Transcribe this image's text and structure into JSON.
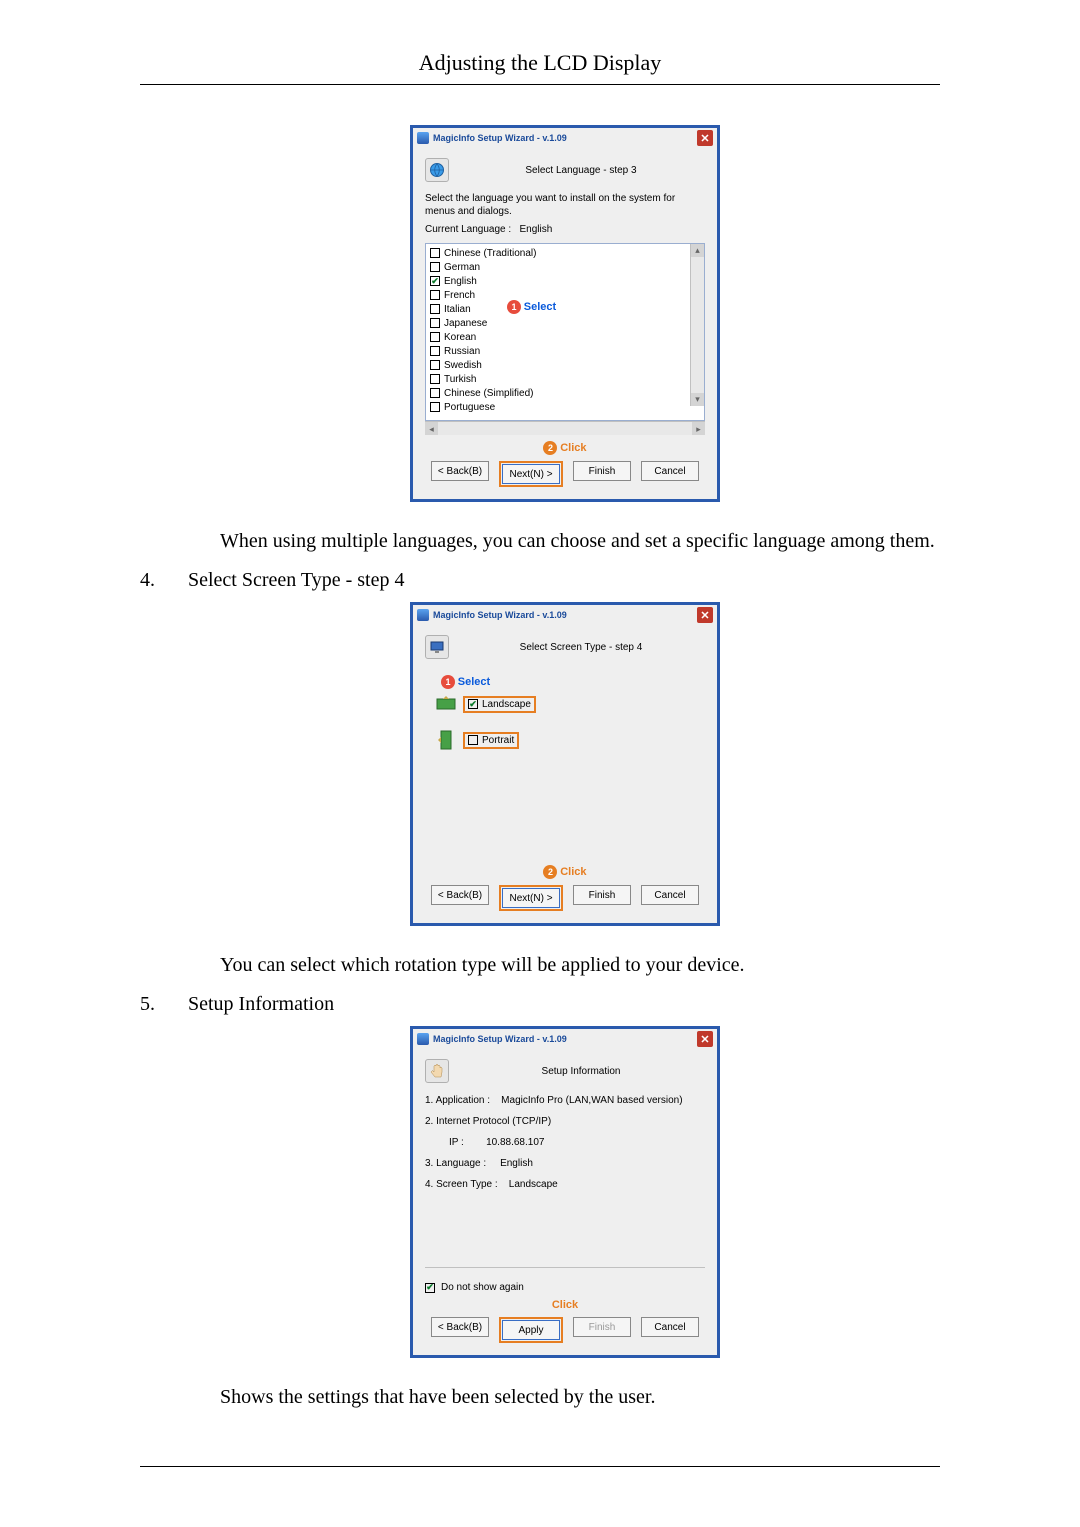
{
  "header": {
    "title": "Adjusting the LCD Display"
  },
  "wizard_common": {
    "title": "MagicInfo Setup Wizard - v.1.09",
    "back": "< Back(B)",
    "next": "Next(N) >",
    "finish": "Finish",
    "cancel": "Cancel",
    "apply": "Apply"
  },
  "callouts": {
    "select": "Select",
    "click": "Click"
  },
  "step3": {
    "heading": "Select Language - step 3",
    "intro": "Select the language you want to install on the system for menus and dialogs.",
    "current_label": "Current Language :",
    "current_value": "English",
    "langs": [
      {
        "name": "Chinese (Traditional)",
        "checked": false
      },
      {
        "name": "German",
        "checked": false
      },
      {
        "name": "English",
        "checked": true
      },
      {
        "name": "French",
        "checked": false
      },
      {
        "name": "Italian",
        "checked": false
      },
      {
        "name": "Japanese",
        "checked": false
      },
      {
        "name": "Korean",
        "checked": false
      },
      {
        "name": "Russian",
        "checked": false
      },
      {
        "name": "Swedish",
        "checked": false
      },
      {
        "name": "Turkish",
        "checked": false
      },
      {
        "name": "Chinese (Simplified)",
        "checked": false
      },
      {
        "name": "Portuguese",
        "checked": false
      }
    ]
  },
  "step4": {
    "heading": "Select Screen Type - step 4",
    "landscape": "Landscape",
    "portrait": "Portrait"
  },
  "step5": {
    "heading": "Setup Information",
    "app_label": "1. Application :",
    "app_value": "MagicInfo Pro (LAN,WAN based version)",
    "ip_section": "2. Internet Protocol (TCP/IP)",
    "ip_label": "IP :",
    "ip_value": "10.88.68.107",
    "lang_label": "3. Language :",
    "lang_value": "English",
    "screen_label": "4. Screen Type :",
    "screen_value": "Landscape",
    "donot": "Do not show again"
  },
  "para": {
    "p1": "When using multiple languages, you can choose and set a specific language among them.",
    "li4_num": "4.",
    "li4_text": "Select Screen Type - step 4",
    "p2": "You can select which rotation type will be applied to your device.",
    "li5_num": "5.",
    "li5_text": "Setup Information",
    "p3": "Shows the settings that have been selected by the user."
  }
}
